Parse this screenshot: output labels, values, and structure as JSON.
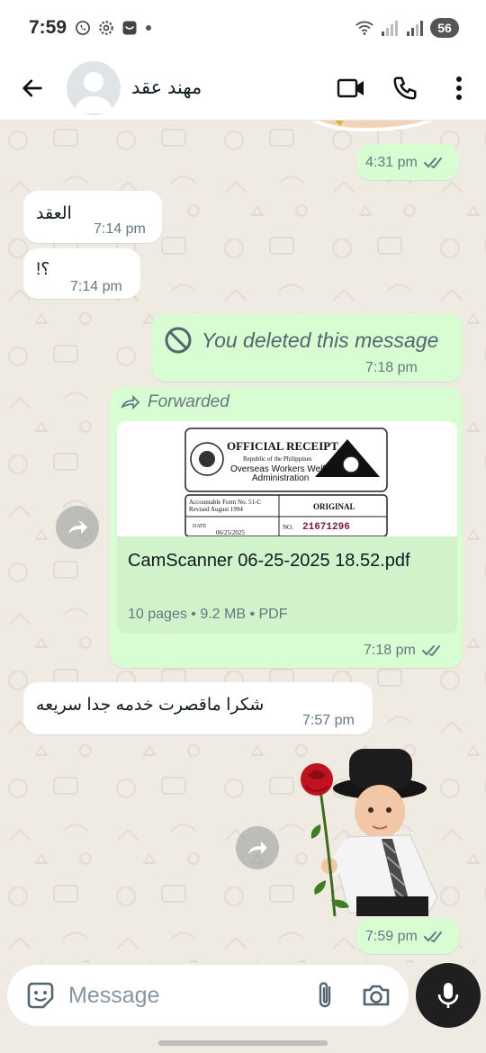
{
  "status_bar": {
    "time": "7:59",
    "battery": "56"
  },
  "header": {
    "contact_name": "مهند عقد"
  },
  "messages": [
    {
      "time": "4:31 pm"
    },
    {
      "text": "العقد",
      "time": "7:14 pm"
    },
    {
      "text": "؟!",
      "time": "7:14 pm"
    },
    {
      "text": "You deleted this message",
      "time": "7:18 pm"
    },
    {
      "forwarded_label": "Forwarded",
      "doc_name": "CamScanner 06-25-2025 18.52.pdf",
      "doc_info": "10 pages • 9.2 MB • PDF",
      "time": "7:18 pm",
      "preview": {
        "title": "OFFICIAL RECEIPT",
        "subtitle1": "Republic of the Philippines",
        "subtitle2": "Overseas Workers Welfare",
        "subtitle3": "Administration",
        "form": "Accountable Form No. 51-C",
        "revised": "Revised August 1994",
        "original": "ORIGINAL",
        "date_label": "DATE",
        "date_value": "06/25/2025",
        "no_label": "NO.",
        "number": "21671296"
      }
    },
    {
      "text": "شكرا ماقصرت خدمه جدا سريعه",
      "time": "7:57 pm"
    },
    {
      "time": "7:59 pm"
    }
  ],
  "composer": {
    "placeholder": "Message"
  },
  "colors": {
    "outgoing": "#d9fdd3",
    "incoming": "#ffffff",
    "read_ticks": "#53bdeb",
    "background": "#efeae2"
  }
}
